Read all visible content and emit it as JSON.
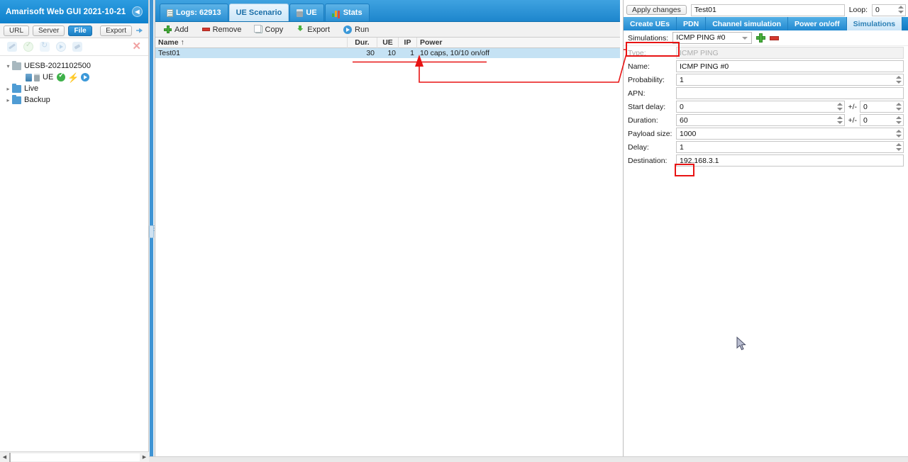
{
  "left_panel": {
    "title": "Amarisoft Web GUI 2021-10-21",
    "collapse_icon": "chevron-left-icon",
    "toolbar": {
      "url_label": "URL",
      "server_label": "Server",
      "file_label": "File",
      "export_label": "Export",
      "connect_icon": "plug-icon"
    },
    "tree_toolbar": {
      "icons": [
        "wrench-icon",
        "check-circle-icon",
        "refresh-icon",
        "play-circle-icon",
        "plug-icon"
      ],
      "close_icon": "close-x-icon"
    },
    "tree": [
      {
        "label": "UESB-2021102500",
        "arrow": "▾",
        "type": "folder-open",
        "depth": 0
      },
      {
        "label": "UE",
        "arrow": "",
        "type": "leaf",
        "depth": 1,
        "status_icons": [
          "ue-server-icon",
          "ue-device-icon",
          "status-ok-icon",
          "bolt-icon",
          "play-icon"
        ]
      },
      {
        "label": "Live",
        "arrow": "▸",
        "type": "folder",
        "depth": 0
      },
      {
        "label": "Backup",
        "arrow": "▸",
        "type": "folder",
        "depth": 0
      }
    ],
    "hscroll": {
      "left_arrow": "◀",
      "right_arrow": "▶"
    }
  },
  "center_panel": {
    "tabs": [
      {
        "label": "Logs: 62913",
        "icon": "document-icon",
        "active": false
      },
      {
        "label": "UE Scenario",
        "icon": "",
        "active": true
      },
      {
        "label": "UE",
        "icon": "ue-device-icon",
        "active": false
      },
      {
        "label": "Stats",
        "icon": "bar-chart-icon",
        "active": false
      }
    ],
    "actions": [
      {
        "label": "Add",
        "icon": "plus-icon"
      },
      {
        "label": "Remove",
        "icon": "minus-icon"
      },
      {
        "label": "Copy",
        "icon": "copy-icon"
      },
      {
        "label": "Export",
        "icon": "export-icon"
      },
      {
        "label": "Run",
        "icon": "run-icon"
      }
    ],
    "grid": {
      "columns": [
        "Name ↑",
        "Dur.",
        "UE",
        "IP",
        "Power"
      ],
      "rows": [
        {
          "name": "Test01",
          "dur": "30",
          "ue": "10",
          "ip": "1",
          "power": "10 caps, 10/10 on/off",
          "selected": true
        }
      ]
    }
  },
  "right_panel": {
    "apply_label": "Apply changes",
    "scenario_name": "Test01",
    "loop_label": "Loop:",
    "loop_value": "0",
    "subtabs": [
      {
        "label": "Create UEs",
        "active": false
      },
      {
        "label": "PDN",
        "active": false
      },
      {
        "label": "Channel simulation",
        "active": false
      },
      {
        "label": "Power on/off",
        "active": false
      },
      {
        "label": "Simulations",
        "active": true
      }
    ],
    "simulations_row": {
      "label": "Simulations:",
      "selected": "ICMP PING #0",
      "add_icon": "plus-icon",
      "remove_icon": "minus-icon"
    },
    "form": [
      {
        "label": "Type:",
        "value": "ICMP PING",
        "disabled": true,
        "spinner": false,
        "pm": false
      },
      {
        "label": "Name:",
        "value": "ICMP PING #0",
        "disabled": false,
        "spinner": false,
        "pm": false
      },
      {
        "label": "Probability:",
        "value": "1",
        "disabled": false,
        "spinner": true,
        "pm": false
      },
      {
        "label": "APN:",
        "value": "",
        "disabled": false,
        "spinner": false,
        "pm": false
      },
      {
        "label": "Start delay:",
        "value": "0",
        "disabled": false,
        "spinner": true,
        "pm": true,
        "pm_label": "+/-",
        "pm_value": "0"
      },
      {
        "label": "Duration:",
        "value": "60",
        "disabled": false,
        "spinner": true,
        "pm": true,
        "pm_label": "+/-",
        "pm_value": "0",
        "highlighted": true
      },
      {
        "label": "Payload size:",
        "value": "1000",
        "disabled": false,
        "spinner": true,
        "pm": false
      },
      {
        "label": "Delay:",
        "value": "1",
        "disabled": false,
        "spinner": true,
        "pm": false
      },
      {
        "label": "Destination:",
        "value": "192.168.3.1",
        "disabled": false,
        "spinner": false,
        "pm": false
      }
    ]
  },
  "annotations": {
    "highlight_color": "#e81414",
    "apply_changes_box": true,
    "duration_box": true,
    "arrow_from_apply_to_row": true,
    "underline_under_row_values": true
  },
  "colors": {
    "brand_blue": "#1a8fd8",
    "tab_active_bg": "#d5eafa",
    "row_selected_bg": "#c5e2f4",
    "annotation_red": "#e81414",
    "status_green": "#3fb14a",
    "status_yellow": "#f3b517"
  }
}
